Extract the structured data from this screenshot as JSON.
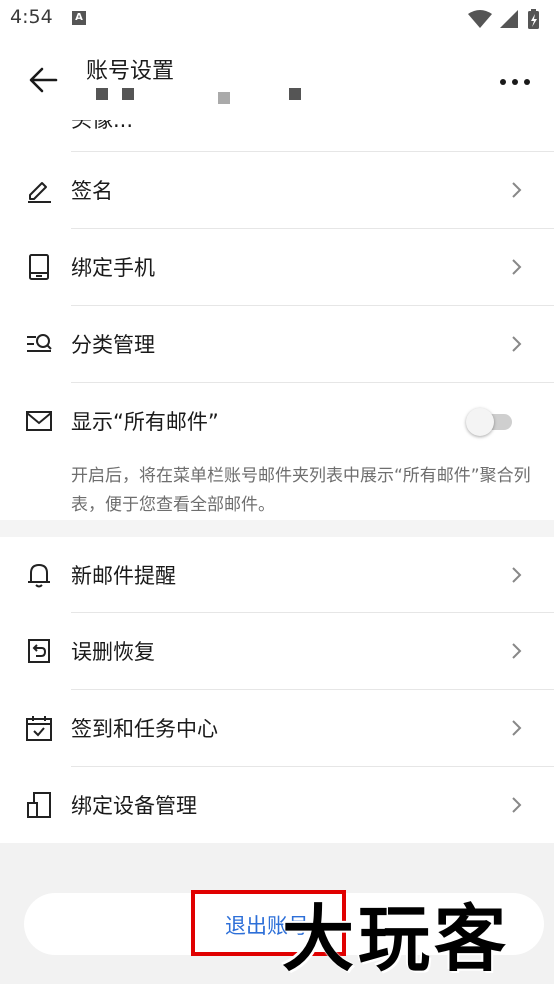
{
  "status_bar": {
    "time": "4:54",
    "badge": "A"
  },
  "header": {
    "title": "账号设置",
    "subtitle": ""
  },
  "partial_row_label": "头像...",
  "rows": [
    {
      "label": "签名"
    },
    {
      "label": "绑定手机"
    },
    {
      "label": "分类管理"
    },
    {
      "label": "显示“所有邮件”"
    },
    {
      "label": "新邮件提醒"
    },
    {
      "label": "误删恢复"
    },
    {
      "label": "签到和任务中心"
    },
    {
      "label": "绑定设备管理"
    }
  ],
  "toggle": {
    "on": false
  },
  "description": "开启后，将在菜单栏账号邮件夹列表中展示“所有邮件”聚合列表，便于您查看全部邮件。",
  "logout_label": "退出账号",
  "watermark": "大玩客",
  "colors": {
    "accent": "#2d6fd8",
    "highlight": "#e00000",
    "muted": "#6e6e6e"
  }
}
